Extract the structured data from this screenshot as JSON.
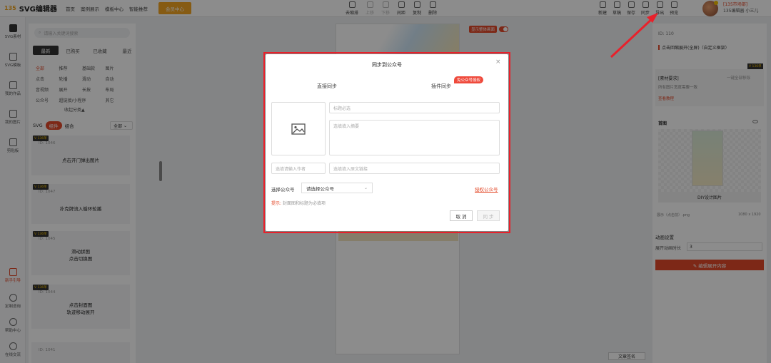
{
  "header": {
    "logo_mark": "135",
    "logo_text": "SVG编辑器",
    "nav": [
      "首页",
      "案例展示",
      "模板中心",
      "智能推荐"
    ],
    "vip_label": "会员中心",
    "edit_tools": [
      {
        "label": "去缩排",
        "enabled": true
      },
      {
        "label": "上移",
        "enabled": false
      },
      {
        "label": "下移",
        "enabled": false
      },
      {
        "label": "间距",
        "enabled": true
      },
      {
        "label": "复制",
        "enabled": true
      },
      {
        "label": "删除",
        "enabled": true
      }
    ],
    "right_tools": [
      "新建",
      "草稿",
      "保存",
      "同步",
      "导出",
      "预览"
    ],
    "account_tag": "[135市场部]",
    "account_name": "135编辑器 小三儿"
  },
  "left_rail": {
    "items": [
      "SVG素材",
      "SVG模板",
      "我的作品",
      "我的图片",
      "剪贴板",
      "新手引导",
      "定制咨询",
      "帮助中心",
      "在线交流"
    ]
  },
  "library": {
    "search_placeholder": "请输入关键词搜索",
    "tabs": [
      "最新",
      "已购买",
      "已收藏",
      "最近"
    ],
    "categories": [
      "全部",
      "推荐",
      "基础款",
      "图片",
      "点击",
      "轮播",
      "滑动",
      "自动",
      "音视频",
      "展开",
      "长按",
      "布局",
      "公众号",
      "超链接/小程序",
      "其它"
    ],
    "collapse_label": "收起分类▲",
    "type_filters": [
      "SVG",
      "组件",
      "组合"
    ],
    "filter_value": "全部",
    "cards": [
      {
        "badge": "V 136单",
        "id": "ID: 1046",
        "name": "点击开门弹出图片"
      },
      {
        "badge": "V 136单",
        "id": "ID: 1047",
        "name": "扑克牌流入循环轮播"
      },
      {
        "badge": "V 136单",
        "id": "ID: 1045",
        "name": "滑动拼图\n点击切换图"
      },
      {
        "badge": "V 136单",
        "id": "ID: 1044",
        "name": "点击封面图\n轨迹移动展开"
      },
      {
        "badge": "",
        "id": "ID: 1041",
        "name": ""
      }
    ]
  },
  "canvas": {
    "mode_label": "显示整体画面",
    "share_label": "文章签名"
  },
  "right_panel": {
    "id": "ID: 110",
    "title": "点击回缩展开(全屏)（自定义框架）",
    "vip_badge": "V 136单",
    "req_label": "[素材要求]",
    "req_right": "一键全部移除",
    "req_desc": "所有图片宽度需要一致",
    "tutorial": "查看教程",
    "cover_label": "首图",
    "diy_label": "DIY设计图片",
    "file_name": "展示（点击前）.png",
    "file_size": "1080 x 1920",
    "anim_label": "动画设置",
    "duration_label": "展开动画时长",
    "duration_value": "3",
    "edit_btn": "✎ 编辑展开内容"
  },
  "modal": {
    "title": "同步到公众号",
    "close": "×",
    "tab_direct": "直接同步",
    "tab_plugin": "插件同步",
    "plugin_badge": "免公众号授权",
    "title_placeholder": "标题必选",
    "summary_placeholder": "选填填入摘要",
    "author_placeholder": "选填请输入作者",
    "link_placeholder": "选填填入原文链接",
    "account_label": "选择公众号",
    "account_select": "请选择公众号",
    "authorize_link": "授权公众号",
    "tip_label": "提示:",
    "tip_text": "封面图和标题为必填项",
    "cancel": "取 消",
    "sync": "同 步"
  },
  "colors": {
    "accent": "#e34a2a",
    "highlight_frame": "#e8212b",
    "vip": "#f5a623"
  }
}
